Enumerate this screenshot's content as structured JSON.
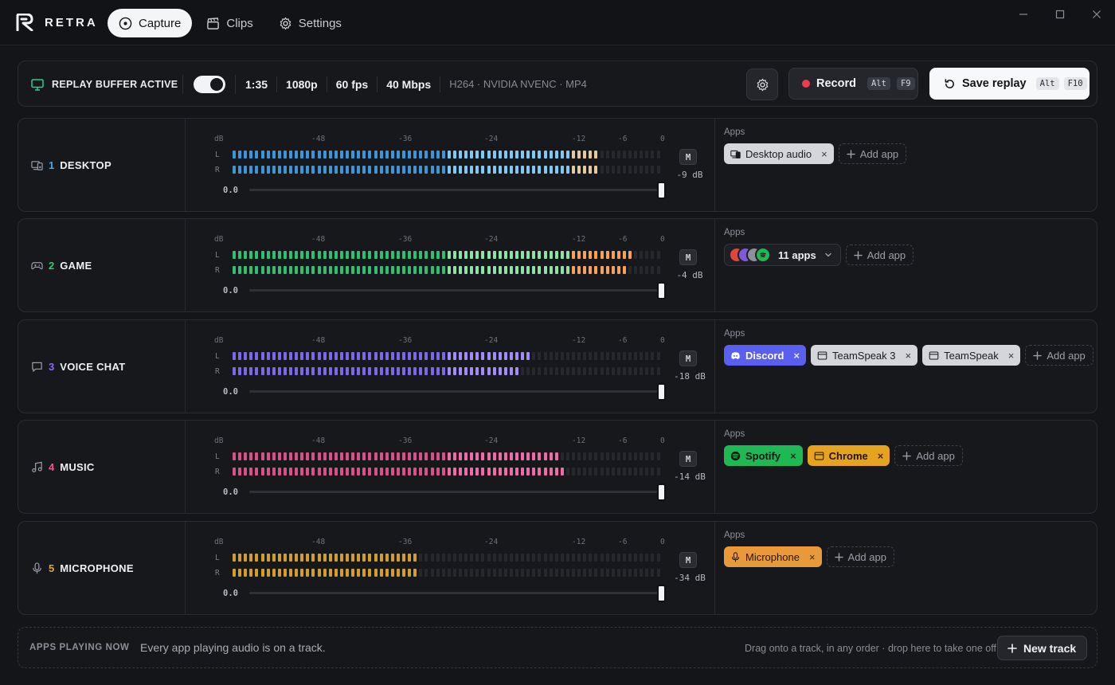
{
  "app": {
    "brand": "RETRA"
  },
  "nav": [
    {
      "label": "Capture",
      "icon": "capture-icon",
      "active": true
    },
    {
      "label": "Clips",
      "icon": "clapper-icon",
      "active": false
    },
    {
      "label": "Settings",
      "icon": "gear-icon",
      "active": false
    }
  ],
  "status": {
    "title": "REPLAY BUFFER ACTIVE",
    "toggle_on": true,
    "duration": "1:35",
    "resolution": "1080p",
    "fps": "60 fps",
    "bitrate": "40 Mbps",
    "codec": "H264 · NVIDIA NVENC · MP4",
    "record_label": "Record",
    "record_keys": [
      "Alt",
      "F9"
    ],
    "save_label": "Save replay",
    "save_keys": [
      "Alt",
      "F10"
    ]
  },
  "meter_scale": [
    "dB",
    "-48",
    "-36",
    "-24",
    "-12",
    "-6",
    "0"
  ],
  "channel_labels": [
    "L",
    "R"
  ],
  "mute_label": "M",
  "apps_label": "Apps",
  "add_app_label": "Add app",
  "tracks": [
    {
      "num": "1",
      "name": "DESKTOP",
      "icon": "desktop-audio-icon",
      "accent": "#3fa9f5",
      "volume": "0.0",
      "db": "-9 dB",
      "level_L": 0.86,
      "level_R": 0.85,
      "palette": "blue",
      "apps": [
        {
          "label": "Desktop audio",
          "style": "gray",
          "icon": "desktop-audio-icon"
        }
      ]
    },
    {
      "num": "2",
      "name": "GAME",
      "icon": "gamepad-icon",
      "accent": "#2ecc71",
      "volume": "0.0",
      "db": "-4 dB",
      "level_L": 0.93,
      "level_R": 0.92,
      "palette": "green",
      "apps_group": {
        "label": "11 apps"
      }
    },
    {
      "num": "3",
      "name": "VOICE CHAT",
      "icon": "chat-icon",
      "accent": "#8b6cf0",
      "volume": "0.0",
      "db": "-18 dB",
      "level_L": 0.7,
      "level_R": 0.67,
      "palette": "purple",
      "apps": [
        {
          "label": "Discord",
          "style": "purple",
          "icon": "discord-icon"
        },
        {
          "label": "TeamSpeak 3",
          "style": "gray",
          "icon": "window-icon"
        },
        {
          "label": "TeamSpeak",
          "style": "gray",
          "icon": "window-icon"
        }
      ]
    },
    {
      "num": "4",
      "name": "MUSIC",
      "icon": "music-icon",
      "accent": "#e9558f",
      "volume": "0.0",
      "db": "-14 dB",
      "level_L": 0.76,
      "level_R": 0.78,
      "palette": "pink",
      "apps": [
        {
          "label": "Spotify",
          "style": "green",
          "icon": "spotify-icon"
        },
        {
          "label": "Chrome",
          "style": "amber",
          "icon": "window-icon"
        }
      ]
    },
    {
      "num": "5",
      "name": "MICROPHONE",
      "icon": "microphone-icon",
      "accent": "#e2a728",
      "volume": "0.0",
      "db": "-34 dB",
      "level_L": 0.44,
      "level_R": 0.44,
      "palette": "gold",
      "apps": [
        {
          "label": "Microphone",
          "style": "orange",
          "icon": "microphone-icon"
        }
      ]
    }
  ],
  "footer": {
    "title": "APPS PLAYING NOW",
    "message": "Every app playing audio is on a track.",
    "hint": "Drag onto a track, in any order · drop here to take one off",
    "new_track_label": "New track"
  }
}
